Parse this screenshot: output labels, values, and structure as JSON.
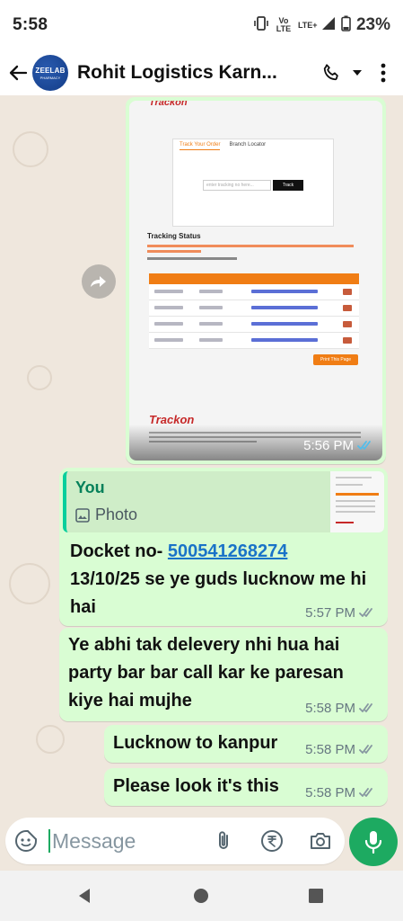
{
  "status_bar": {
    "time": "5:58",
    "volte": "Vo LTE",
    "network": "LTE+",
    "battery": "23%"
  },
  "header": {
    "back_icon": "arrow-left-icon",
    "avatar_text": "ZEELAB",
    "avatar_sub": "PHARMACY",
    "title": "Rohit Logistics Karn...",
    "call_icon": "phone-icon",
    "dropdown_icon": "chevron-down-icon",
    "menu_icon": "more-vertical-icon"
  },
  "messages": [
    {
      "type": "image",
      "time": "5:56 PM",
      "status": "read",
      "image_content": {
        "tab_active": "Track Your Order",
        "tab_other": "Branch Locator",
        "input_placeholder": "enter tracking no here...",
        "button": "Track",
        "section_title": "Tracking Status",
        "print_button": "Print This Page",
        "brand": "Trackon"
      }
    },
    {
      "type": "reply",
      "quote_author": "You",
      "quote_type": "Photo",
      "text_before_link": "Docket no- ",
      "link": "500541268274",
      "text_after_link": "13/10/25 se ye guds lucknow me hi hai",
      "time": "5:57 PM",
      "status": "delivered"
    },
    {
      "type": "text",
      "text": "Ye abhi tak delevery nhi hua hai party bar bar call kar ke paresan kiye hai mujhe",
      "time": "5:58 PM",
      "status": "delivered"
    },
    {
      "type": "text",
      "text": "Lucknow to kanpur",
      "time": "5:58 PM",
      "status": "delivered"
    },
    {
      "type": "text",
      "text": "Please look it's this",
      "time": "5:58 PM",
      "status": "delivered"
    }
  ],
  "composer": {
    "placeholder": "Message",
    "emoji_icon": "sticker-icon",
    "attach_icon": "paperclip-icon",
    "payment_icon": "rupee-icon",
    "camera_icon": "camera-icon",
    "mic_icon": "mic-icon",
    "accent": "#1daa61"
  },
  "nav_bar": {
    "back": "triangle-back-icon",
    "home": "circle-home-icon",
    "recents": "square-recents-icon"
  },
  "colors": {
    "outgoing_bubble": "#d9fdd3",
    "chat_bg": "#efe7dd",
    "read_ticks": "#53bdeb",
    "link": "#1a73c8"
  }
}
